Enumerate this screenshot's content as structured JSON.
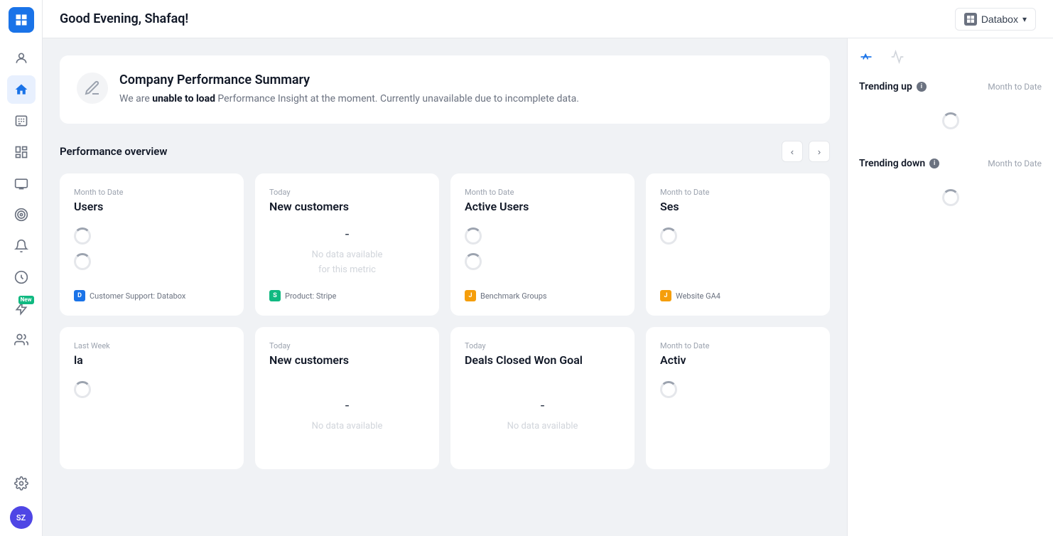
{
  "app": {
    "logo_label": "Databox Logo"
  },
  "header": {
    "greeting": "Good Evening, Shafaq!",
    "databox_btn_label": "Databox",
    "databox_chevron": "▾"
  },
  "sidebar": {
    "items": [
      {
        "id": "user-profile",
        "icon": "person",
        "active": false
      },
      {
        "id": "home",
        "icon": "home",
        "active": true
      },
      {
        "id": "metrics",
        "icon": "123",
        "active": false
      },
      {
        "id": "dashboards",
        "icon": "bar-chart",
        "active": false
      },
      {
        "id": "tv",
        "icon": "tv",
        "active": false
      },
      {
        "id": "goals",
        "icon": "target",
        "active": false
      },
      {
        "id": "alerts",
        "icon": "bell",
        "active": false
      },
      {
        "id": "analytics",
        "icon": "circle",
        "active": false
      },
      {
        "id": "new-feature",
        "icon": "lightning",
        "active": false,
        "badge": "New"
      },
      {
        "id": "team",
        "icon": "people",
        "active": false
      }
    ],
    "bottom_items": [
      {
        "id": "settings",
        "icon": "gear"
      },
      {
        "id": "avatar",
        "label": "SZ"
      }
    ]
  },
  "summary_card": {
    "title": "Company Performance Summary",
    "body_prefix": "We are ",
    "body_bold": "unable to load",
    "body_suffix": " Performance Insight at the moment. Currently unavailable due to incomplete data."
  },
  "performance_overview": {
    "title": "Performance overview",
    "nav_prev": "‹",
    "nav_next": "›"
  },
  "metric_cards_row1": [
    {
      "period": "Month to Date",
      "name": "Users",
      "state": "loading",
      "value": "",
      "source_icon_type": "blue",
      "source_icon_letter": "D",
      "source_label": "Customer Support: Databox"
    },
    {
      "period": "Today",
      "name": "New customers",
      "state": "dash_nodata",
      "value": "-",
      "no_data_text": "No data available\nfor this metric",
      "source_icon_type": "green",
      "source_icon_letter": "S",
      "source_label": "Product: Stripe"
    },
    {
      "period": "Month to Date",
      "name": "Active Users",
      "state": "loading",
      "value": "",
      "source_icon_type": "orange",
      "source_icon_letter": "J",
      "source_label": "Benchmark Groups"
    },
    {
      "period": "Month to Date",
      "name": "Ses",
      "state": "loading",
      "value": "",
      "source_icon_type": "orange",
      "source_icon_letter": "J",
      "source_label": "Website GA4",
      "partial": true
    }
  ],
  "metric_cards_row2": [
    {
      "period": "Last Week",
      "name": "la",
      "state": "loading",
      "value": ""
    },
    {
      "period": "Today",
      "name": "New customers",
      "state": "dash_nodata",
      "value": "-",
      "no_data_text": "No data available"
    },
    {
      "period": "Today",
      "name": "Deals Closed Won Goal",
      "state": "dash_nodata",
      "value": "-",
      "no_data_text": "No data available"
    },
    {
      "period": "Month to Date",
      "name": "Activ",
      "state": "loading",
      "value": "",
      "partial": true
    }
  ],
  "right_panel": {
    "trending_up_label": "Trending up",
    "trending_up_period": "Month to Date",
    "trending_down_label": "Trending down",
    "trending_down_period": "Month to Date"
  }
}
